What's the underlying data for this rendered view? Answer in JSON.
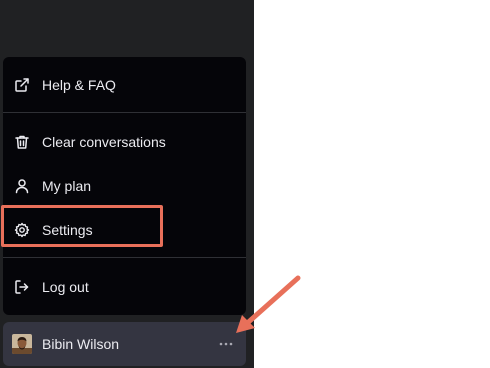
{
  "menu": {
    "items": [
      {
        "label": "Help & FAQ",
        "icon": "external-link-icon"
      },
      {
        "label": "Clear conversations",
        "icon": "trash-icon"
      },
      {
        "label": "My plan",
        "icon": "user-icon"
      },
      {
        "label": "Settings",
        "icon": "gear-icon"
      },
      {
        "label": "Log out",
        "icon": "logout-icon"
      }
    ]
  },
  "user": {
    "name": "Bibin Wilson",
    "more_icon": "more-horizontal-icon"
  },
  "colors": {
    "sidebar_bg": "#202123",
    "menu_bg": "#050509",
    "user_row_bg": "#343541",
    "text": "#ececf1",
    "annotation": "#e8705a"
  }
}
